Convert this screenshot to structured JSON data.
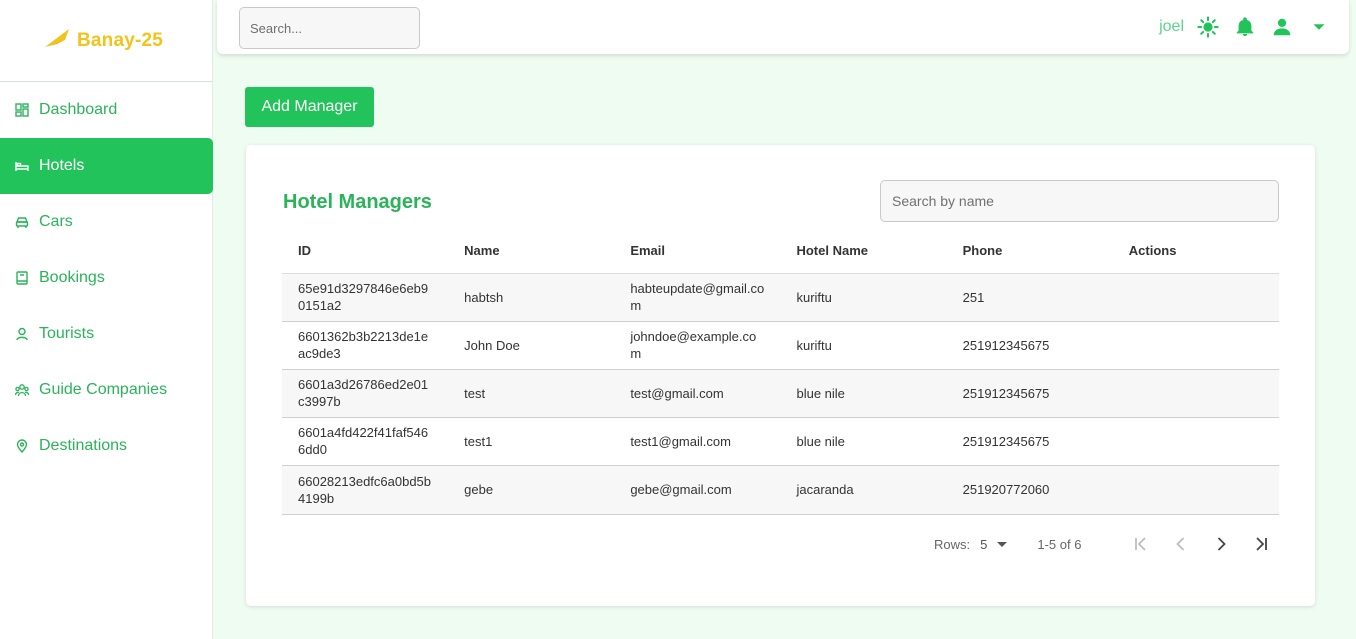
{
  "brand": {
    "name": "Banay-25"
  },
  "sidebar": {
    "items": [
      {
        "label": "Dashboard",
        "icon": "dashboard-icon",
        "active": false
      },
      {
        "label": "Hotels",
        "icon": "bed-icon",
        "active": true
      },
      {
        "label": "Cars",
        "icon": "car-icon",
        "active": false
      },
      {
        "label": "Bookings",
        "icon": "book-icon",
        "active": false
      },
      {
        "label": "Tourists",
        "icon": "user-icon",
        "active": false
      },
      {
        "label": "Guide Companies",
        "icon": "group-icon",
        "active": false
      },
      {
        "label": "Destinations",
        "icon": "location-pin-icon",
        "active": false
      }
    ]
  },
  "header": {
    "search_placeholder": "Search...",
    "username": "joel"
  },
  "main": {
    "add_button_label": "Add Manager",
    "card": {
      "title": "Hotel Managers",
      "search_placeholder": "Search by name",
      "columns": [
        "ID",
        "Name",
        "Email",
        "Hotel Name",
        "Phone",
        "Actions"
      ],
      "rows": [
        [
          "65e91d3297846e6eb90151a2",
          "habtsh",
          "habteupdate@gmail.com",
          "kuriftu",
          "251",
          ""
        ],
        [
          "6601362b3b2213de1eac9de3",
          "John Doe",
          "johndoe@example.com",
          "kuriftu",
          "251912345675",
          ""
        ],
        [
          "6601a3d26786ed2e01c3997b",
          "test",
          "test@gmail.com",
          "blue nile",
          "251912345675",
          ""
        ],
        [
          "6601a4fd422f41faf5466dd0",
          "test1",
          "test1@gmail.com",
          "blue nile",
          "251912345675",
          ""
        ],
        [
          "66028213edfc6a0bd5b4199b",
          "gebe",
          "gebe@gmail.com",
          "jacaranda",
          "251920772060",
          ""
        ]
      ]
    },
    "pagination": {
      "rows_label": "Rows:",
      "rows_value": "5",
      "range_text": "1-5 of 6"
    }
  },
  "colors": {
    "accent": "#22c35a",
    "accent_text": "#2bb35a",
    "brand": "#f2c31a",
    "page_bg": "#effcf2"
  }
}
